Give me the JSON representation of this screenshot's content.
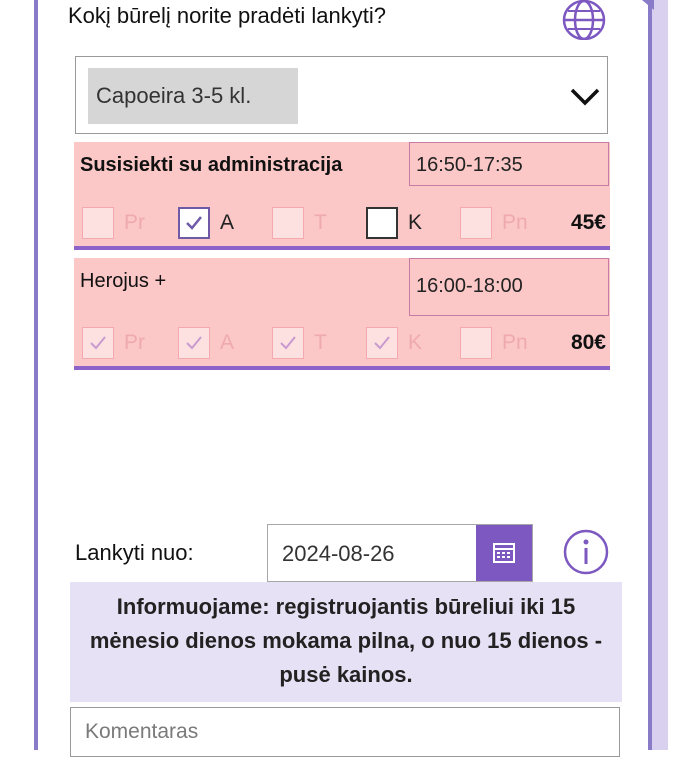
{
  "question": "Kokį būrelį norite pradėti lankyti?",
  "select": {
    "value": "Capoeira 3-5 kl."
  },
  "groups": [
    {
      "title": "Susisiekti su administracija",
      "time": "16:50-17:35",
      "price": "45€",
      "days": [
        {
          "label": "Pr",
          "state": "unchecked"
        },
        {
          "label": "A",
          "state": "checked"
        },
        {
          "label": "T",
          "state": "unchecked"
        },
        {
          "label": "K",
          "state": "blank"
        },
        {
          "label": "Pn",
          "state": "unchecked"
        }
      ]
    },
    {
      "title": "Herojus +",
      "time": "16:00-18:00",
      "price": "80€",
      "days": [
        {
          "label": "Pr",
          "state": "faded-checked"
        },
        {
          "label": "A",
          "state": "faded-checked"
        },
        {
          "label": "T",
          "state": "faded-checked"
        },
        {
          "label": "K",
          "state": "faded-checked"
        },
        {
          "label": "Pn",
          "state": "unchecked"
        }
      ]
    }
  ],
  "date": {
    "label": "Lankyti nuo:",
    "value": "2024-08-26"
  },
  "notice": "Informuojame: registruojantis būreliui iki 15 mėnesio dienos mokama pilna, o nuo 15 dienos - pusė kainos.",
  "comment": {
    "placeholder": "Komentaras"
  },
  "colors": {
    "accent": "#7c58c0",
    "row_bg": "#fbc7c7",
    "notice_bg": "#e6e1f4"
  },
  "icons": [
    "globe-icon",
    "chevron-down-icon",
    "calendar-icon",
    "info-icon",
    "check-icon"
  ]
}
